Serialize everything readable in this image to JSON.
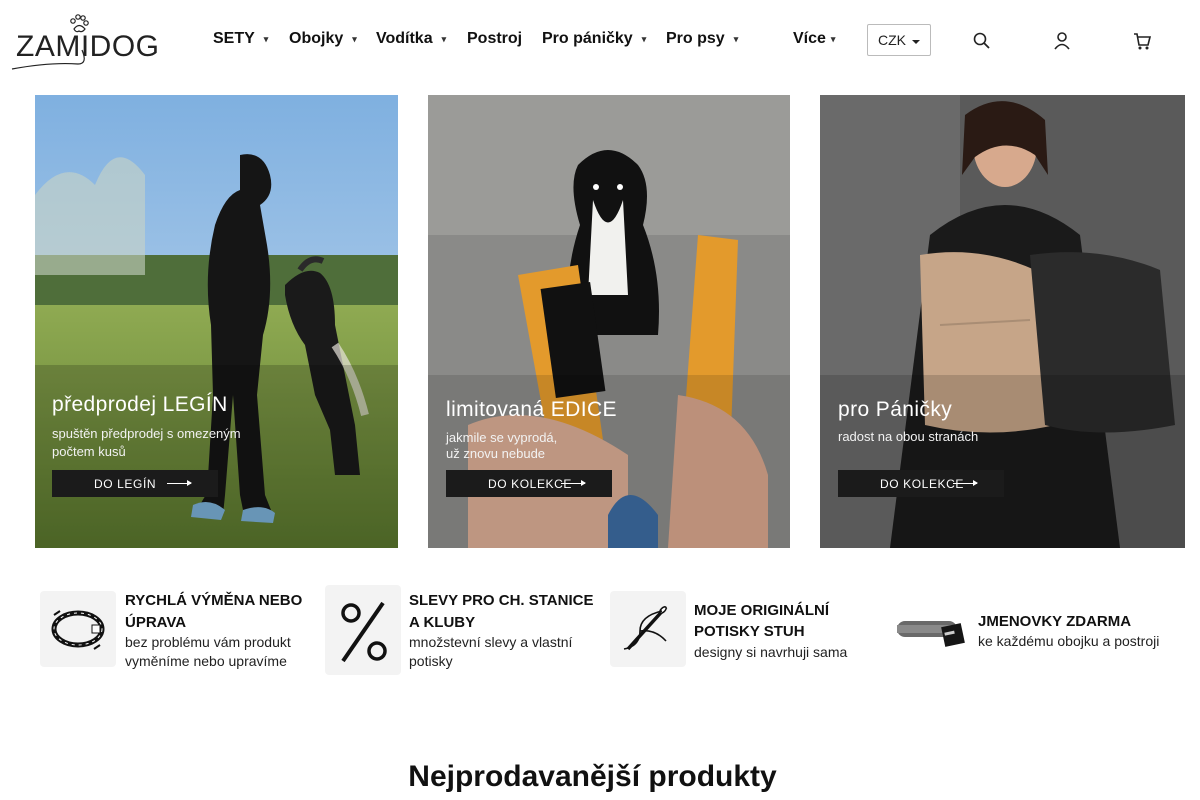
{
  "brand": {
    "logo_text": "ZAMIDOG"
  },
  "nav": {
    "items": [
      {
        "label": "SETY",
        "has_caret": true
      },
      {
        "label": "Obojky",
        "has_caret": true
      },
      {
        "label": "Vodítka",
        "has_caret": true
      },
      {
        "label": "Postroj",
        "has_caret": false
      },
      {
        "label": "Pro páničky",
        "has_caret": true
      },
      {
        "label": "Pro psy",
        "has_caret": true
      },
      {
        "label": "Více",
        "has_caret": true
      }
    ],
    "currency": {
      "selected": "CZK"
    },
    "icons": [
      "search-icon",
      "user-icon",
      "cart-icon"
    ]
  },
  "banners": [
    {
      "title": "předprodej  LEGÍN",
      "subtitle_line1": "spuštěn předprodej s omezeným",
      "subtitle_line2": "počtem kusů",
      "button_label": "DO LEGÍN"
    },
    {
      "title": "limitovaná EDICE",
      "subtitle_line1": "jakmile se vyprodá,",
      "subtitle_line2": "už znovu nebude",
      "button_label": "DO KOLEKCE"
    },
    {
      "title": "pro Páničky",
      "subtitle_line1": "radost na obou stranách",
      "subtitle_line2": "",
      "button_label": "DO KOLEKCE"
    }
  ],
  "benefits": [
    {
      "title_line1": "RYCHLÁ VÝMĚNA NEBO",
      "title_line2": "ÚPRAVA",
      "text_line1": "bez problému vám produkt",
      "text_line2": "vyměníme nebo upravíme",
      "icon": "collar-exchange-icon"
    },
    {
      "title_line1": "SLEVY PRO CH. STANICE",
      "title_line2": "A KLUBY",
      "text_line1": "množstevní slevy a vlastní",
      "text_line2": "potisky",
      "icon": "percent-icon"
    },
    {
      "title_line1": "MOJE ORIGINÁLNÍ",
      "title_line2": "POTISKY STUH",
      "text_line1": "designy si navrhuji sama",
      "text_line2": "",
      "icon": "needle-thread-icon"
    },
    {
      "title_line1": "JMENOVKY ZDARMA",
      "title_line2": "",
      "text_line1": "ke každému obojku a postroji",
      "text_line2": "",
      "icon": "collar-nametag-icon"
    }
  ],
  "section": {
    "title": "Nejprodavanější produkty"
  }
}
